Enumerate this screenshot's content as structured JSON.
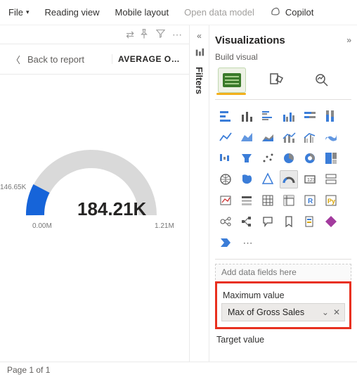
{
  "menu": {
    "file": "File",
    "reading_view": "Reading view",
    "mobile_layout": "Mobile layout",
    "open_data_model": "Open data model",
    "copilot": "Copilot"
  },
  "report": {
    "back": "Back to report",
    "header": "AVERAGE OF …"
  },
  "gauge": {
    "callout_label": "146.65K",
    "value": "184.21K",
    "min": "0.00M",
    "max": "1.21M"
  },
  "filters": {
    "label": "Filters"
  },
  "viz": {
    "title": "Visualizations",
    "subtitle": "Build visual",
    "add_placeholder": "Add data fields here",
    "max_label": "Maximum value",
    "max_field": "Max of Gross Sales",
    "target_label": "Target value"
  },
  "footer": {
    "page": "Page 1 of 1"
  },
  "colors": {
    "gauge_fill": "#1664d9",
    "gauge_track": "#d9d9d9",
    "highlight": "#e8301f"
  }
}
